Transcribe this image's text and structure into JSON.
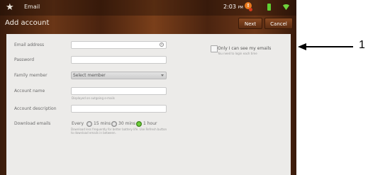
{
  "statusbar": {
    "app_icon": "android-app-icon",
    "app_name": "Email",
    "time": "2:03",
    "time_suffix": "PM",
    "notification_icon": "notification-icon",
    "battery_icon": "battery-icon",
    "wifi_icon": "wifi-icon"
  },
  "titlebar": {
    "title": "Add account",
    "next_label": "Next",
    "cancel_label": "Cancel"
  },
  "form": {
    "email_label": "Email address",
    "email_value": "",
    "password_label": "Password",
    "password_value": "",
    "family_label": "Family member",
    "family_value": "Select member",
    "account_name_label": "Account name",
    "account_name_value": "",
    "account_name_hint": "Displayed on outgoing e-mails",
    "account_desc_label": "Account description",
    "account_desc_value": "",
    "download_label": "Download emails",
    "download_every": "Every",
    "download_options": [
      {
        "label": "15 mins",
        "selected": false
      },
      {
        "label": "30 mins",
        "selected": false
      },
      {
        "label": "1 hour",
        "selected": true
      }
    ],
    "download_hint": "Download less frequently for better battery life. Use Refresh button to download emails in between.",
    "only_me_label": "Only I can see my emails",
    "only_me_hint": "You need to login each time",
    "only_me_checked": false
  },
  "annotation": {
    "number": "1"
  },
  "colors": {
    "wood_dark": "#3a1c0c",
    "wood_light": "#7a3f1a",
    "panel": "#ecebe9",
    "radio_selected": "#6fd33b"
  }
}
